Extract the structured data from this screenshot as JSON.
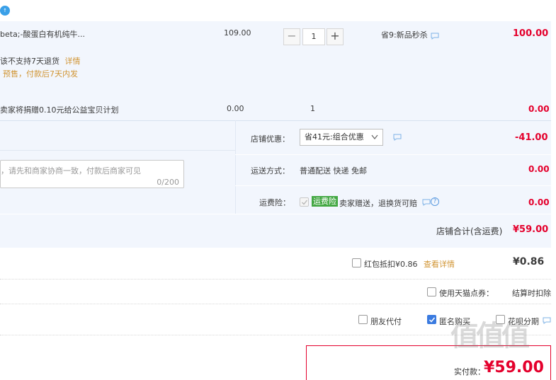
{
  "product": {
    "name": "beta;-酸蛋白有机纯牛...",
    "unit_price": "109.00",
    "quantity": "1",
    "promo": "省9:新品秒杀",
    "subtotal": "100.00",
    "return_policy": "该不支持7天退货",
    "return_link": "详情",
    "presale_note": "预售，付款后7天内发"
  },
  "charity": {
    "text": "卖家将捐赠0.10元给公益宝贝计划",
    "price": "0.00",
    "quantity": "1",
    "subtotal": "0.00"
  },
  "shop": {
    "discount_label": "店铺优惠：",
    "discount_select": "省41元:组合优惠",
    "discount_amount": "-41.00",
    "shipping_label": "运送方式：",
    "shipping_value": "普通配送 快递 免邮",
    "shipping_amount": "0.00",
    "insurance_label": "运费险：",
    "insurance_badge": "运费险",
    "insurance_text": "卖家赠送，退换货可赔",
    "insurance_amount": "0.00",
    "message_placeholder": "，请先和商家协商一致，付款后商家可见",
    "message_counter": "0/200",
    "total_label": "店铺合计(含运费)",
    "total_value": "¥59.00"
  },
  "redpacket": {
    "label": "红包抵扣¥0.86",
    "link": "查看详情",
    "amount": "¥0.86"
  },
  "tmall_points": {
    "label": "使用天猫点券：",
    "note": "结算时扣除"
  },
  "payment_options": {
    "friend_pay": "朋友代付",
    "anonymous": "匿名购买",
    "huabei": "花呗分期"
  },
  "footer": {
    "label": "实付款：",
    "amount": "¥59.00",
    "watermark": "值值值"
  },
  "colors": {
    "accent_red": "#e4002c",
    "link_orange": "#d19636",
    "panel_blue": "#f2f6fd",
    "checkbox_blue": "#3b7be0",
    "badge_green": "#44a844"
  }
}
